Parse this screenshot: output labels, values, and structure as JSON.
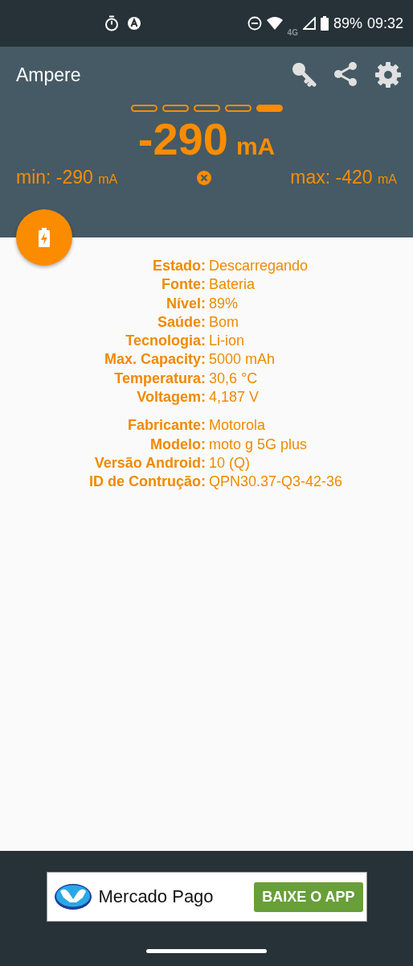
{
  "status_bar": {
    "network": "4G",
    "battery": "89%",
    "time": "09:32"
  },
  "app_bar": {
    "title": "Ampere"
  },
  "pager": [
    {
      "selected": false
    },
    {
      "selected": false
    },
    {
      "selected": false
    },
    {
      "selected": false
    },
    {
      "selected": true
    }
  ],
  "reading": {
    "value": "-290",
    "unit": "mA"
  },
  "min": {
    "label": "min:",
    "value": "-290",
    "unit": "mA"
  },
  "max": {
    "label": "max:",
    "value": "-420",
    "unit": "mA"
  },
  "info_groups": [
    [
      {
        "label": "Estado:",
        "value": "Descarregando"
      },
      {
        "label": "Fonte:",
        "value": "Bateria"
      },
      {
        "label": "Nível:",
        "value": "89%"
      },
      {
        "label": "Saúde:",
        "value": "Bom"
      },
      {
        "label": "Tecnologia:",
        "value": "Li-ion"
      },
      {
        "label": "Max. Capacity:",
        "value": "5000 mAh"
      },
      {
        "label": "Temperatura:",
        "value": "30,6 °C"
      },
      {
        "label": "Voltagem:",
        "value": "4,187 V"
      }
    ],
    [
      {
        "label": "Fabricante:",
        "value": "Motorola"
      },
      {
        "label": "Modelo:",
        "value": "moto g 5G plus"
      },
      {
        "label": "Versão Android:",
        "value": "10 (Q)"
      },
      {
        "label": "ID de Contrução:",
        "value": "QPN30.37-Q3-42-36"
      }
    ]
  ],
  "ad": {
    "brand": "Mercado Pago",
    "button": "BAIXE O APP"
  }
}
